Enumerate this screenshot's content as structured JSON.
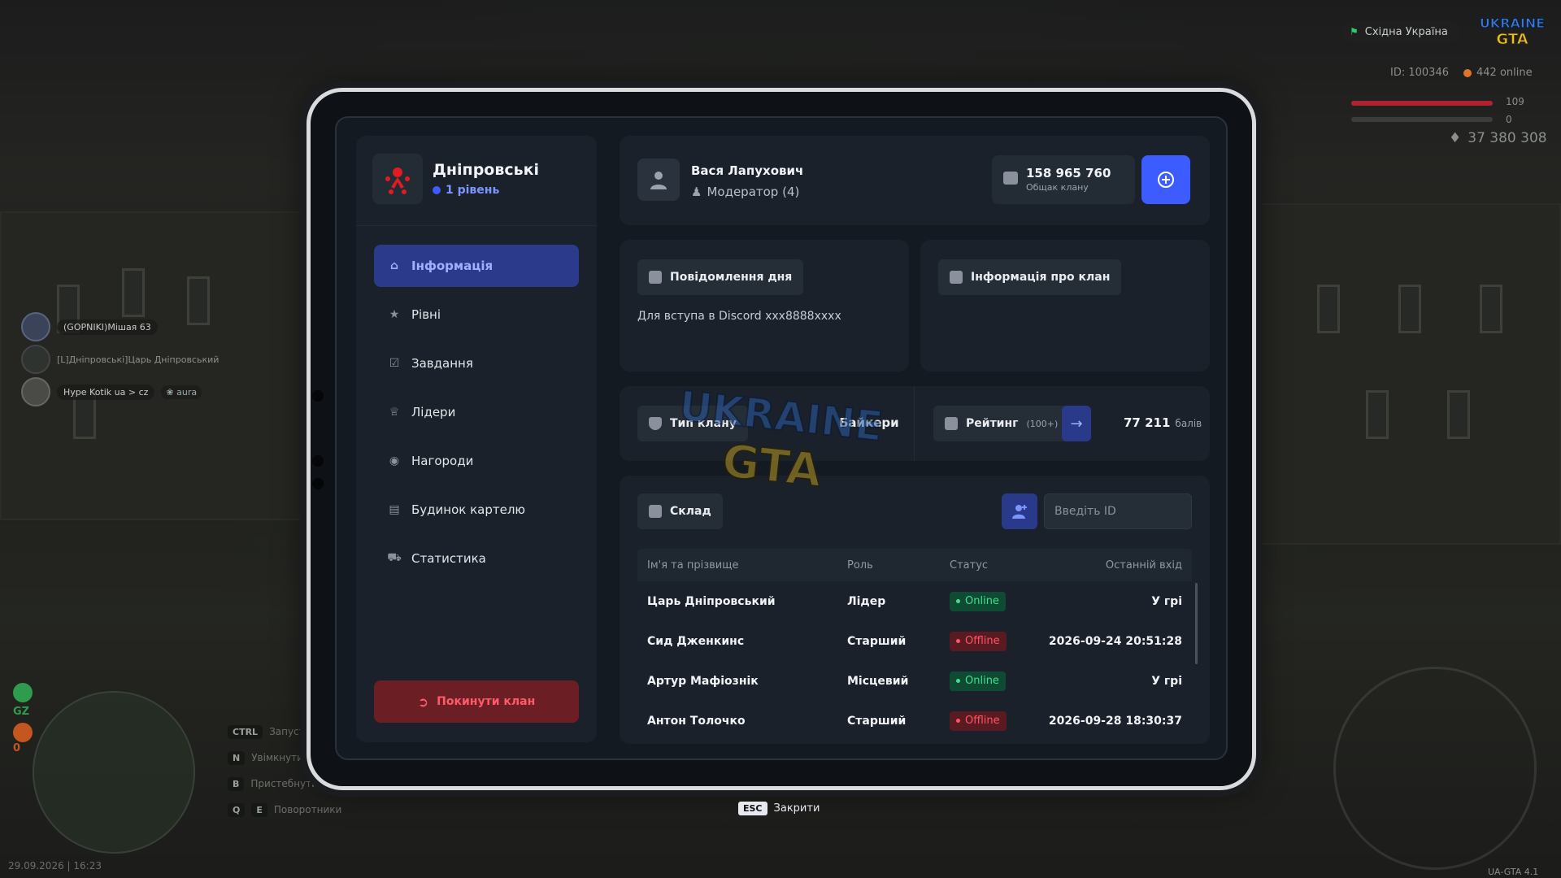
{
  "hud": {
    "region": "Східна Україна",
    "player_id": "ID: 100346",
    "online": "442 online",
    "health": "109",
    "armor": "0",
    "money": "37 380 308",
    "gz_label": "GZ",
    "gz_count": "0",
    "datetime": "29.09.2026 | 16:23",
    "version": "UA-GTA 4.1",
    "keys": [
      {
        "key": "CTRL",
        "label": "Запуст"
      },
      {
        "key": "N",
        "label": "Увімкнути"
      },
      {
        "key": "B",
        "label": "Пристебнути"
      },
      {
        "key": "Q",
        "key2": "E",
        "label": "Поворотники"
      }
    ]
  },
  "feed": [
    {
      "name": "(GOPNIKI)Мішая 63",
      "tag": ""
    },
    {
      "name": "[L]Дніпровські]Царь Дніпровський",
      "tag": ""
    },
    {
      "name": "Hype Kotik ua > cz",
      "tag": "aura"
    }
  ],
  "clan": {
    "name": "Дніпровські",
    "level": "1 рівень"
  },
  "nav": [
    {
      "label": "Інформація",
      "icon": "home-icon",
      "active": true
    },
    {
      "label": "Рівні",
      "icon": "star-icon"
    },
    {
      "label": "Завдання",
      "icon": "check-icon"
    },
    {
      "label": "Лідери",
      "icon": "crown-icon"
    },
    {
      "label": "Нагороди",
      "icon": "medal-icon"
    },
    {
      "label": "Будинок картелю",
      "icon": "building-icon"
    },
    {
      "label": "Статистика",
      "icon": "car-icon"
    }
  ],
  "leave_label": "Покинути клан",
  "user": {
    "name": "Вася Лапухович",
    "role": "Модератор (4)"
  },
  "balance": {
    "amount": "158 965 760",
    "label": "Общак клану"
  },
  "message_of_day": {
    "title": "Повідомлення дня",
    "text": "Для вступа в Discord xxx8888xxxx"
  },
  "clan_info": {
    "title": "Інформація про клан"
  },
  "clan_type": {
    "label": "Тип клану",
    "value": "Байкери"
  },
  "rating": {
    "label": "Рейтинг",
    "sub": "(100+)",
    "value": "77 211",
    "unit": "балів"
  },
  "members": {
    "title": "Склад",
    "id_placeholder": "Введіть ID",
    "columns": [
      "Ім'я та прізвище",
      "Роль",
      "Статус",
      "Останній вхід"
    ],
    "rows": [
      {
        "name": "Царь Дніпровський",
        "role": "Лідер",
        "status": "Online",
        "last": "У грі"
      },
      {
        "name": "Сид Дженкинс",
        "role": "Старший",
        "status": "Offline",
        "last": "2026-09-24 20:51:28"
      },
      {
        "name": "Артур Мафіознік",
        "role": "Місцевий",
        "status": "Online",
        "last": "У грі"
      },
      {
        "name": "Антон Толочко",
        "role": "Старший",
        "status": "Offline",
        "last": "2026-09-28 18:30:37"
      }
    ]
  },
  "close_hint": {
    "key": "ESC",
    "label": "Закрити"
  },
  "colors": {
    "accent": "#3d5cff",
    "active_nav": "#2b3a8a",
    "online": "#3fe08e",
    "offline": "#ff5566",
    "danger": "#6b1f25"
  }
}
